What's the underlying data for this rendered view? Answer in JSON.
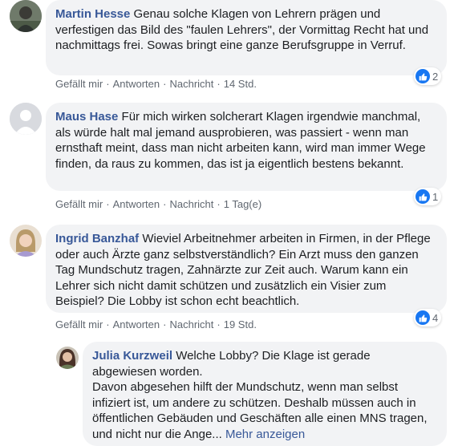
{
  "comments": [
    {
      "author": "Martin Hesse",
      "text": "Genau solche Klagen von Lehrern prägen und verfestigen das Bild des \"faulen Lehrers\", der Vormittag Recht hat und nachmittags frei. Sowas bringt eine ganze Berufsgruppe in Verruf.",
      "actions": {
        "like": "Gefällt mir",
        "reply": "Antworten",
        "message": "Nachricht",
        "time": "14 Std."
      },
      "reactions": "2"
    },
    {
      "author": "Maus Hase",
      "text": "Für mich wirken solcherart Klagen irgendwie manchmal, als würde halt mal jemand ausprobieren, was passiert - wenn man ernsthaft meint, dass man nicht arbeiten kann, wird man immer Wege finden, da raus zu kommen, das ist ja eigentlich bestens bekannt.",
      "actions": {
        "like": "Gefällt mir",
        "reply": "Antworten",
        "message": "Nachricht",
        "time": "1 Tag(e)"
      },
      "reactions": "1"
    },
    {
      "author": "Ingrid Banzhaf",
      "text": "Wieviel Arbeitnehmer arbeiten in Firmen, in der Pflege oder auch Ärzte ganz selbstverständlich? Ein Arzt muss den ganzen Tag Mundschutz tragen, Zahnärzte zur Zeit auch. Warum kann ein Lehrer sich nicht damit schützen und zusätzlich ein Visier zum Beispiel? Die Lobby ist schon echt beachtlich.",
      "actions": {
        "like": "Gefällt mir",
        "reply": "Antworten",
        "message": "Nachricht",
        "time": "19 Std."
      },
      "reactions": "4"
    }
  ],
  "reply": {
    "author": "Julia Kurzweil",
    "text1": "Welche Lobby? Die Klage ist gerade abgewiesen worden.",
    "text2": "Davon abgesehen hilft der Mundschutz, wenn man selbst infiziert ist, um andere zu schützen. Deshalb müssen auch in öffentlichen Gebäuden und Geschäften alle einen MNS tragen, und nicht nur die Ange...",
    "more": "Mehr anzeigen"
  },
  "icons": {
    "reaction": "like-icon",
    "avatar_default": "default-avatar-icon"
  },
  "colors": {
    "author": "#385898",
    "bubble": "#f2f3f5",
    "like": "#1877f2",
    "meta": "#606770"
  }
}
